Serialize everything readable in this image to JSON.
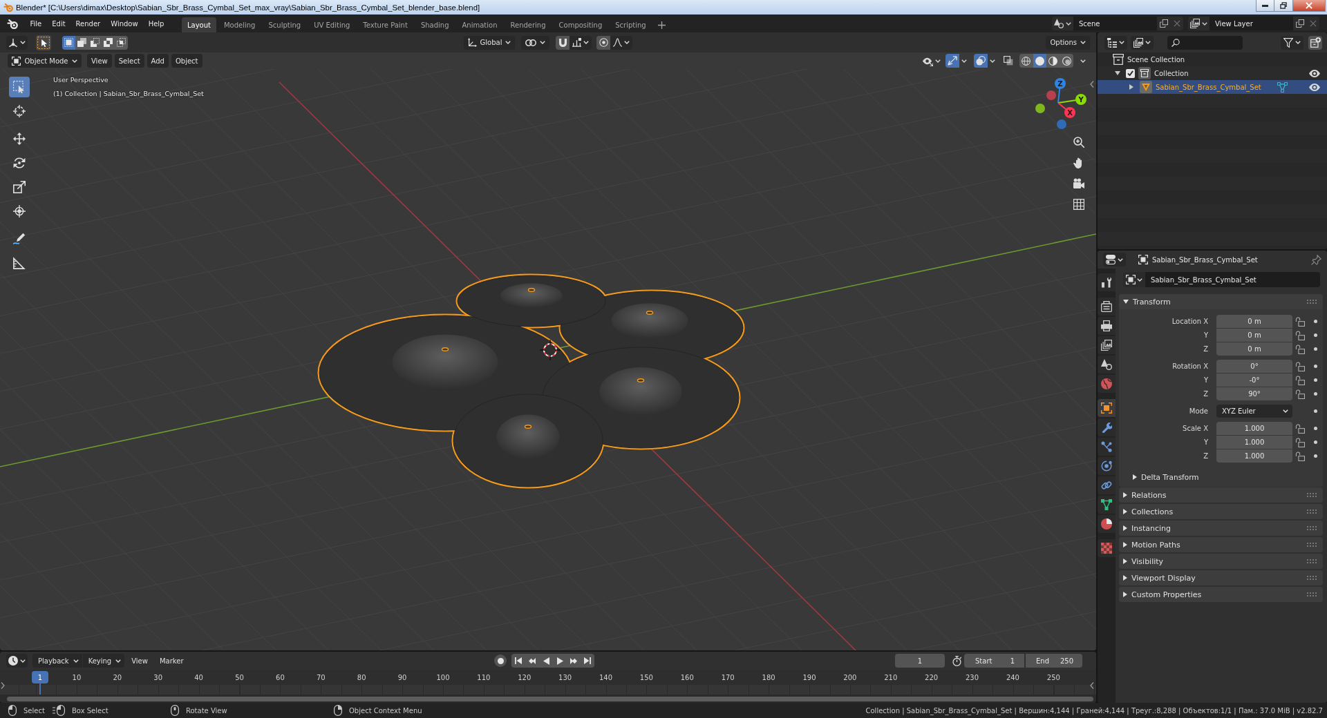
{
  "window": {
    "title": "Blender* [C:\\Users\\dimax\\Desktop\\Sabian_Sbr_Brass_Cymbal_Set_max_vray\\Sabian_Sbr_Brass_Cymbal_Set_blender_base.blend]"
  },
  "menu": [
    "File",
    "Edit",
    "Render",
    "Window",
    "Help"
  ],
  "workspaces": [
    {
      "label": "Layout",
      "selected": true
    },
    {
      "label": "Modeling",
      "selected": false
    },
    {
      "label": "Sculpting",
      "selected": false
    },
    {
      "label": "UV Editing",
      "selected": false
    },
    {
      "label": "Texture Paint",
      "selected": false
    },
    {
      "label": "Shading",
      "selected": false
    },
    {
      "label": "Animation",
      "selected": false
    },
    {
      "label": "Rendering",
      "selected": false
    },
    {
      "label": "Compositing",
      "selected": false
    },
    {
      "label": "Scripting",
      "selected": false
    }
  ],
  "scene_selector": {
    "value": "Scene"
  },
  "view_layer_selector": {
    "value": "View Layer"
  },
  "tool_header": {
    "select_modes": [
      {
        "kind": "set",
        "selected": true
      },
      {
        "kind": "extend",
        "selected": false
      },
      {
        "kind": "subtract",
        "selected": false
      },
      {
        "kind": "difference",
        "selected": false
      },
      {
        "kind": "intersect",
        "selected": false
      }
    ],
    "orientation": "Global",
    "options": "Options"
  },
  "viewport": {
    "mode": "Object Mode",
    "menus": [
      "View",
      "Select",
      "Add",
      "Object"
    ],
    "gizmos_on": true,
    "overlays_on": true,
    "xray_on": false,
    "shading": [
      {
        "kind": "wireframe",
        "selected": false
      },
      {
        "kind": "solid",
        "selected": true
      },
      {
        "kind": "material",
        "selected": false
      },
      {
        "kind": "rendered",
        "selected": false
      }
    ],
    "view_name": "User Perspective",
    "info": "(1) Collection | Sabian_Sbr_Brass_Cymbal_Set",
    "tool_groups": [
      {
        "tools": [
          {
            "kind": "select_box",
            "selected": true
          },
          {
            "kind": "cursor",
            "selected": false
          }
        ]
      },
      {
        "tools": [
          {
            "kind": "move",
            "selected": false
          },
          {
            "kind": "rotate",
            "selected": false
          },
          {
            "kind": "scale",
            "selected": false
          },
          {
            "kind": "transform",
            "selected": false
          }
        ]
      },
      {
        "tools": [
          {
            "kind": "annotate",
            "selected": false
          },
          {
            "kind": "measure",
            "selected": false
          }
        ]
      }
    ],
    "gizmo": {
      "x": "X",
      "y": "Y",
      "z": "Z"
    }
  },
  "outliner": {
    "items": [
      {
        "kind": "scene_collection",
        "label": "Scene Collection",
        "selected": false,
        "children": [
          {
            "kind": "collection",
            "label": "Collection",
            "selected": false,
            "expanded": true,
            "checked": true,
            "visible": true,
            "children": [
              {
                "kind": "mesh_object",
                "label": "Sabian_Sbr_Brass_Cymbal_Set",
                "selected": true,
                "expanded": false,
                "visible": true
              }
            ]
          }
        ]
      }
    ]
  },
  "properties": {
    "title": "Sabian_Sbr_Brass_Cymbal_Set",
    "name": "Sabian_Sbr_Brass_Cymbal_Set",
    "tab_groups": [
      {
        "tabs": [
          {
            "kind": "tool",
            "selected": false
          }
        ]
      },
      {
        "tabs": [
          {
            "kind": "render",
            "selected": false
          },
          {
            "kind": "output",
            "selected": false
          },
          {
            "kind": "view_layer",
            "selected": false
          },
          {
            "kind": "scene",
            "selected": false
          },
          {
            "kind": "world",
            "selected": false
          }
        ]
      },
      {
        "tabs": [
          {
            "kind": "object",
            "selected": true
          },
          {
            "kind": "modifiers",
            "selected": false
          },
          {
            "kind": "particles",
            "selected": false
          },
          {
            "kind": "physics",
            "selected": false
          },
          {
            "kind": "constraints",
            "selected": false
          },
          {
            "kind": "data",
            "selected": false
          },
          {
            "kind": "material",
            "selected": false
          }
        ]
      },
      {
        "tabs": [
          {
            "kind": "texture",
            "selected": false
          }
        ]
      }
    ],
    "transform": {
      "title": "Transform",
      "expanded": true,
      "groups": [
        {
          "rows": [
            {
              "kind": "number",
              "label": "Location X",
              "value": "0 m",
              "locked": false
            },
            {
              "kind": "number",
              "label": "Y",
              "value": "0 m",
              "locked": false
            },
            {
              "kind": "number",
              "label": "Z",
              "value": "0 m",
              "locked": false
            }
          ]
        },
        {
          "rows": [
            {
              "kind": "number",
              "label": "Rotation X",
              "value": "0°",
              "locked": false
            },
            {
              "kind": "number",
              "label": "Y",
              "value": "-0°",
              "locked": false
            },
            {
              "kind": "number",
              "label": "Z",
              "value": "90°",
              "locked": false
            }
          ]
        },
        {
          "rows": [
            {
              "kind": "dropdown",
              "label": "Mode",
              "value": "XYZ Euler"
            }
          ]
        },
        {
          "rows": [
            {
              "kind": "number",
              "label": "Scale X",
              "value": "1.000",
              "locked": false
            },
            {
              "kind": "number",
              "label": "Y",
              "value": "1.000",
              "locked": false
            },
            {
              "kind": "number",
              "label": "Z",
              "value": "1.000",
              "locked": false
            }
          ]
        }
      ],
      "subpanels": [
        {
          "title": "Delta Transform",
          "expanded": false
        }
      ]
    },
    "panels": [
      {
        "title": "Relations",
        "expanded": false
      },
      {
        "title": "Collections",
        "expanded": false
      },
      {
        "title": "Instancing",
        "expanded": false
      },
      {
        "title": "Motion Paths",
        "expanded": false
      },
      {
        "title": "Visibility",
        "expanded": false
      },
      {
        "title": "Viewport Display",
        "expanded": false
      },
      {
        "title": "Custom Properties",
        "expanded": false
      }
    ]
  },
  "timeline": {
    "menus": [
      {
        "kind": "dropdown",
        "label": "Playback"
      },
      {
        "kind": "dropdown",
        "label": "Keying"
      },
      {
        "kind": "menu",
        "label": "View"
      },
      {
        "kind": "menu",
        "label": "Marker"
      }
    ],
    "frame": "1",
    "start_label": "Start",
    "start": "1",
    "end_label": "End",
    "end": "250",
    "playhead": "1",
    "ruler": [
      "10",
      "20",
      "30",
      "40",
      "50",
      "60",
      "70",
      "80",
      "90",
      "100",
      "110",
      "120",
      "130",
      "140",
      "150",
      "160",
      "170",
      "180",
      "190",
      "200",
      "210",
      "220",
      "230",
      "240",
      "250"
    ]
  },
  "status_bar": {
    "hints": [
      {
        "kind": "left_click",
        "label": "Select"
      },
      {
        "kind": "left_drag",
        "label": "Box Select"
      },
      {
        "kind": "middle_click",
        "label": "Rotate View"
      },
      {
        "kind": "right_click",
        "label": "Object Context Menu"
      }
    ],
    "stats": "Collection | Sabian_Sbr_Brass_Cymbal_Set | Вершин:4,144 | Граней:4,144 | Треуг.:8,288 | Объектов:1/1 | Пам.: 37.0 MiB | v2.82.7"
  }
}
